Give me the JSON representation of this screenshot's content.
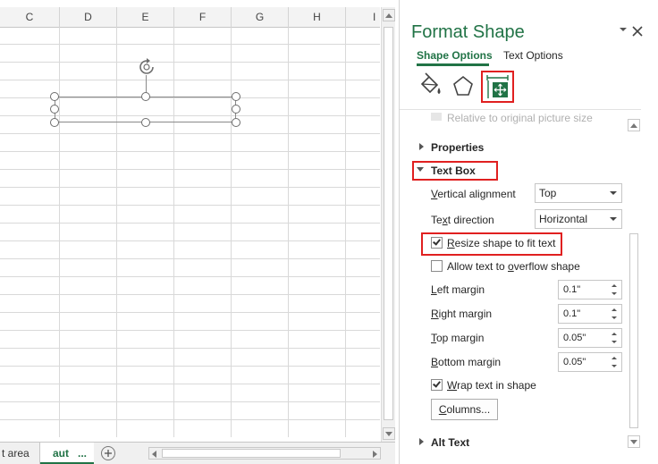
{
  "sheet": {
    "columns": [
      "C",
      "D",
      "E",
      "F",
      "G",
      "H",
      "I"
    ],
    "tabs": [
      {
        "label": "t area"
      },
      {
        "label": "aut",
        "overflow": "..."
      }
    ]
  },
  "panel": {
    "title": "Format Shape",
    "tabs": {
      "shape_options": "Shape Options",
      "text_options": "Text Options"
    },
    "categories": [
      {
        "icon": "fill-line-icon"
      },
      {
        "icon": "effects-pentagon-icon"
      },
      {
        "icon": "size-properties-icon",
        "selected": true
      }
    ],
    "faded_row": "Relative to original picture size",
    "properties_header": "Properties",
    "textbox_header": "Text Box",
    "vertical_alignment": {
      "label_u": "V",
      "label_rest": "ertical alignment",
      "value": "Top"
    },
    "text_direction": {
      "label_pre": "Te",
      "label_u": "x",
      "label_rest": "t direction",
      "value": "Horizontal"
    },
    "resize_shape": {
      "label_u": "R",
      "label_rest": "esize shape to fit text",
      "checked": true
    },
    "allow_overflow": {
      "label_pre": "Allow text to ",
      "label_u": "o",
      "label_rest": "verflow shape",
      "checked": false
    },
    "left_margin": {
      "label_u": "L",
      "label_rest": "eft margin",
      "value": "0.1\""
    },
    "right_margin": {
      "label_u": "R",
      "label_rest": "ight margin",
      "value": "0.1\""
    },
    "top_margin": {
      "label_u": "T",
      "label_rest": "op margin",
      "value": "0.05\""
    },
    "bottom_margin": {
      "label_u": "B",
      "label_rest": "ottom margin",
      "value": "0.05\""
    },
    "wrap_text": {
      "label_u": "W",
      "label_rest": "rap text in shape",
      "checked": true
    },
    "columns_button": {
      "label_u": "C",
      "label_rest": "olumns..."
    },
    "alt_text_header": "Alt Text"
  }
}
